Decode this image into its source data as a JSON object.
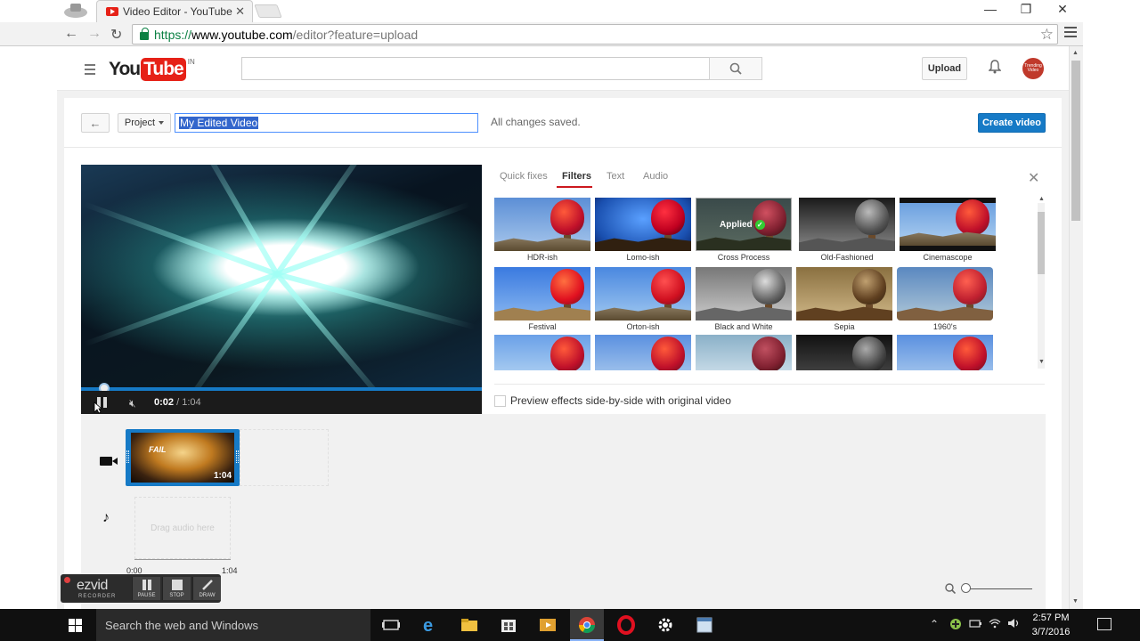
{
  "browser": {
    "tab_title": "Video Editor - YouTube",
    "tab_close": "✕",
    "url_https": "https://",
    "url_host": "www.youtube.com",
    "url_path": "/editor?feature=upload",
    "window_controls": [
      "—",
      "❐",
      "✕"
    ]
  },
  "header": {
    "logo_you": "You",
    "logo_tube": "Tube",
    "logo_region": "IN",
    "search_placeholder": "",
    "upload_label": "Upload",
    "avatar_text": "Trending Video"
  },
  "project": {
    "back_label": "←",
    "dropdown_label": "Project",
    "title_value": "My Edited Video",
    "save_status": "All changes saved.",
    "create_label": "Create video"
  },
  "player": {
    "current_time": "0:02",
    "duration": " / 1:04",
    "progress": 0.03
  },
  "effects": {
    "tabs": [
      {
        "label": "Quick fixes"
      },
      {
        "label": "Filters"
      },
      {
        "label": "Text"
      },
      {
        "label": "Audio"
      }
    ],
    "active_tab": "Filters",
    "close_label": "✕",
    "applied_label": "Applied",
    "filters_row1": [
      "HDR-ish",
      "Lomo-ish",
      "Cross Process",
      "Old-Fashioned",
      "Cinemascope"
    ],
    "filters_row2": [
      "Festival",
      "Orton-ish",
      "Black and White",
      "Sepia",
      "1960's"
    ],
    "applied_filter": "Cross Process",
    "preview_label": "Preview effects side-by-side with original video",
    "preview_checked": false
  },
  "timeline": {
    "clip_title": "FAIL",
    "clip_duration": "1:04",
    "audio_placeholder": "Drag audio here",
    "ruler_start": "0:00",
    "ruler_end": "1:04"
  },
  "recorder": {
    "logo": "ezvid",
    "sub": "RECORDER",
    "buttons": [
      "PAUSE",
      "STOP",
      "DRAW"
    ]
  },
  "taskbar": {
    "search_placeholder": "Search the web and Windows",
    "time": "2:57 PM",
    "date": "3/7/2016"
  }
}
